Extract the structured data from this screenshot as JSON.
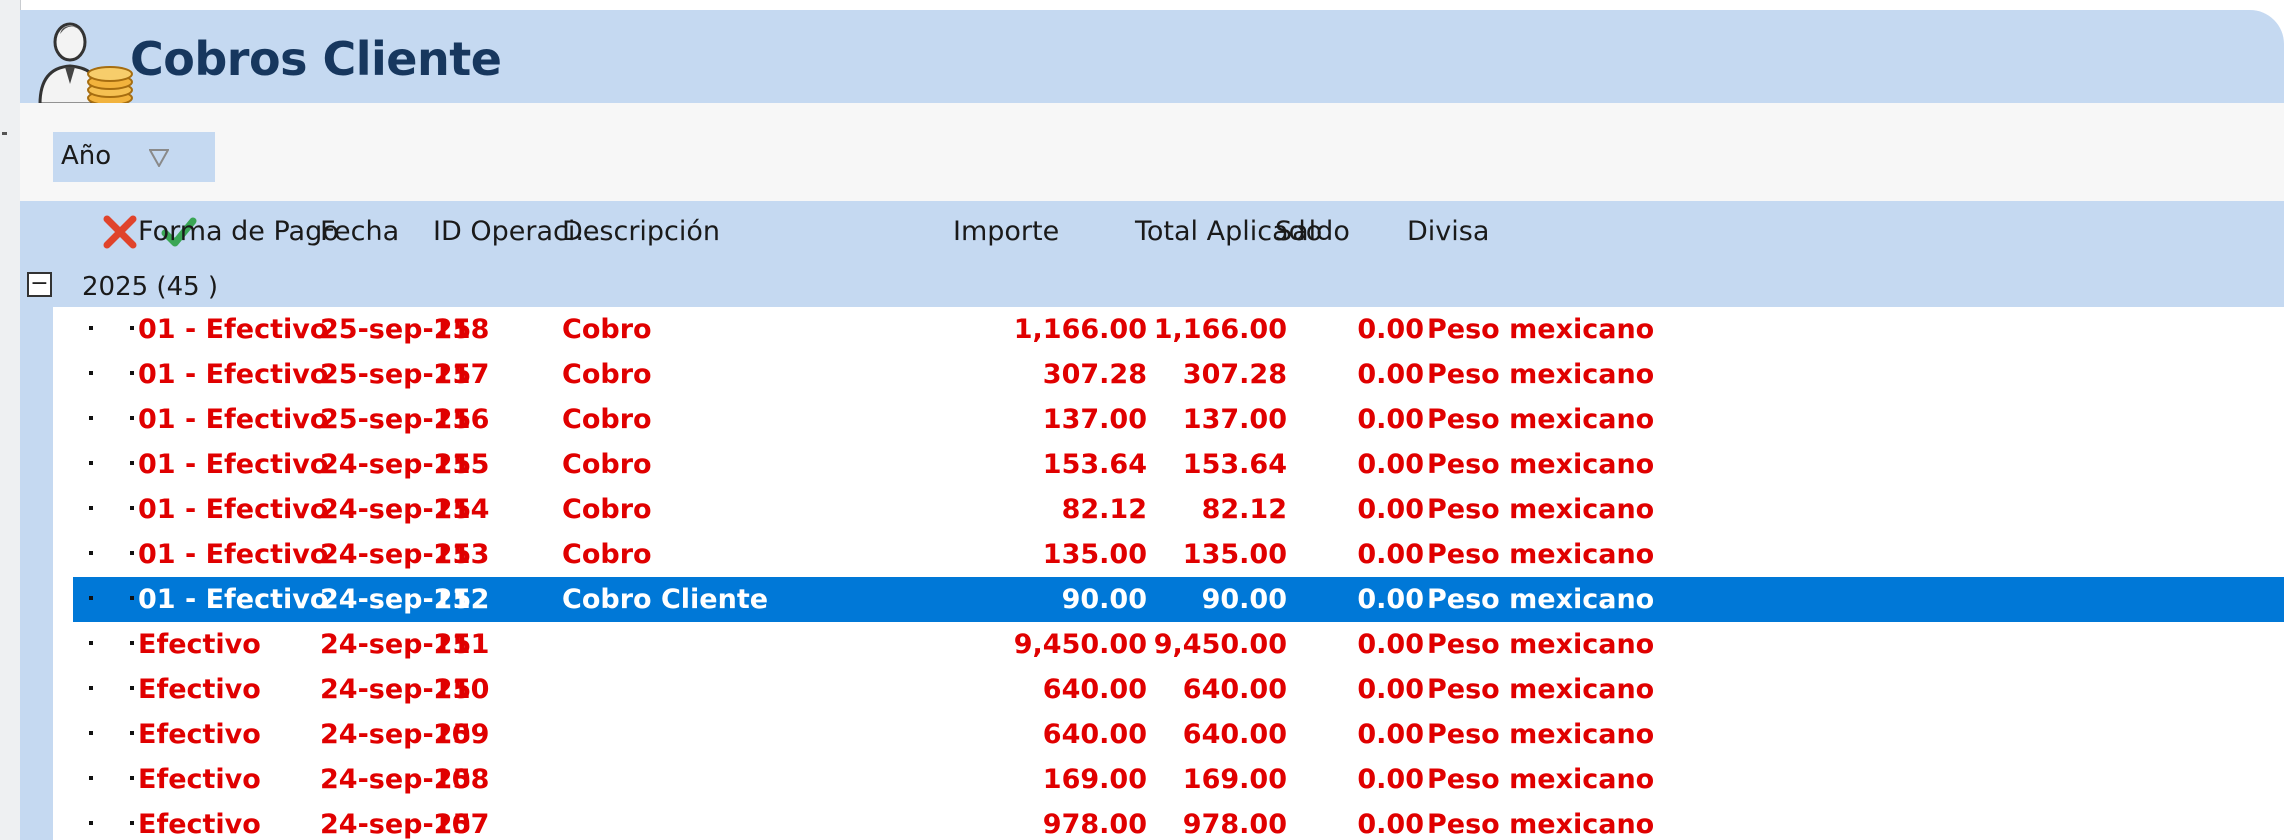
{
  "title": "Cobros Cliente",
  "filter": {
    "label": "Año",
    "icon": "funnel-icon"
  },
  "columns": {
    "forma_pago": "Forma de Pago",
    "fecha": "Fecha",
    "id_operacion": "ID Operaci...",
    "descripcion": "Descripción",
    "importe": "Importe",
    "total_aplicado": "Total Aplicado",
    "saldo": "Saldo",
    "divisa": "Divisa"
  },
  "group": {
    "label": "2025 (45 )",
    "toggle": "−"
  },
  "rows": [
    {
      "forma_pago": "01 - Efectivo",
      "fecha": "25-sep-25",
      "id": "118",
      "descripcion": "Cobro",
      "importe": "1,166.00",
      "total_aplicado": "1,166.00",
      "saldo": "0.00",
      "divisa": "Peso mexicano"
    },
    {
      "forma_pago": "01 - Efectivo",
      "fecha": "25-sep-25",
      "id": "117",
      "descripcion": "Cobro",
      "importe": "307.28",
      "total_aplicado": "307.28",
      "saldo": "0.00",
      "divisa": "Peso mexicano"
    },
    {
      "forma_pago": "01 - Efectivo",
      "fecha": "25-sep-25",
      "id": "116",
      "descripcion": "Cobro",
      "importe": "137.00",
      "total_aplicado": "137.00",
      "saldo": "0.00",
      "divisa": "Peso mexicano"
    },
    {
      "forma_pago": "01 - Efectivo",
      "fecha": "24-sep-25",
      "id": "115",
      "descripcion": "Cobro",
      "importe": "153.64",
      "total_aplicado": "153.64",
      "saldo": "0.00",
      "divisa": "Peso mexicano"
    },
    {
      "forma_pago": "01 - Efectivo",
      "fecha": "24-sep-25",
      "id": "114",
      "descripcion": "Cobro",
      "importe": "82.12",
      "total_aplicado": "82.12",
      "saldo": "0.00",
      "divisa": "Peso mexicano"
    },
    {
      "forma_pago": "01 - Efectivo",
      "fecha": "24-sep-25",
      "id": "113",
      "descripcion": "Cobro",
      "importe": "135.00",
      "total_aplicado": "135.00",
      "saldo": "0.00",
      "divisa": "Peso mexicano"
    },
    {
      "forma_pago": "01 - Efectivo",
      "fecha": "24-sep-25",
      "id": "112",
      "descripcion": "Cobro Cliente",
      "importe": "90.00",
      "total_aplicado": "90.00",
      "saldo": "0.00",
      "divisa": "Peso mexicano",
      "selected": true
    },
    {
      "forma_pago": "Efectivo",
      "fecha": "24-sep-25",
      "id": "111",
      "descripcion": "",
      "importe": "9,450.00",
      "total_aplicado": "9,450.00",
      "saldo": "0.00",
      "divisa": "Peso mexicano"
    },
    {
      "forma_pago": "Efectivo",
      "fecha": "24-sep-25",
      "id": "110",
      "descripcion": "",
      "importe": "640.00",
      "total_aplicado": "640.00",
      "saldo": "0.00",
      "divisa": "Peso mexicano"
    },
    {
      "forma_pago": "Efectivo",
      "fecha": "24-sep-25",
      "id": "109",
      "descripcion": "",
      "importe": "640.00",
      "total_aplicado": "640.00",
      "saldo": "0.00",
      "divisa": "Peso mexicano"
    },
    {
      "forma_pago": "Efectivo",
      "fecha": "24-sep-25",
      "id": "108",
      "descripcion": "",
      "importe": "169.00",
      "total_aplicado": "169.00",
      "saldo": "0.00",
      "divisa": "Peso mexicano"
    },
    {
      "forma_pago": "Efectivo",
      "fecha": "24-sep-25",
      "id": "107",
      "descripcion": "",
      "importe": "978.00",
      "total_aplicado": "978.00",
      "saldo": "0.00",
      "divisa": "Peso mexicano"
    }
  ],
  "colors": {
    "header_bg": "#c5d9f1",
    "title": "#17375e",
    "row_text": "#e00000",
    "selected_bg": "#0078d7",
    "selected_text": "#ffffff"
  }
}
